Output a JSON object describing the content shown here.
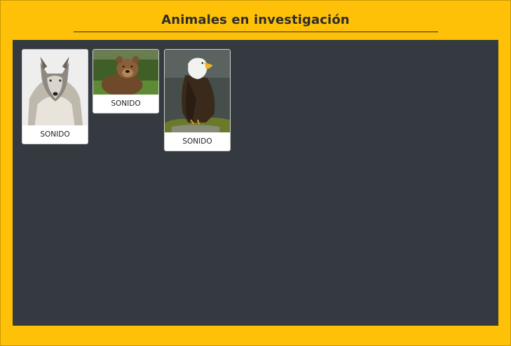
{
  "header": {
    "title": "Animales en investigación"
  },
  "cards": [
    {
      "animal": "wolf",
      "button_label": "SONIDO"
    },
    {
      "animal": "bear",
      "button_label": "SONIDO"
    },
    {
      "animal": "eagle",
      "button_label": "SONIDO"
    }
  ],
  "colors": {
    "frame_background": "#ffc107",
    "panel_background": "#343a40",
    "card_background": "#ffffff",
    "title_color": "#2d2d2d"
  }
}
